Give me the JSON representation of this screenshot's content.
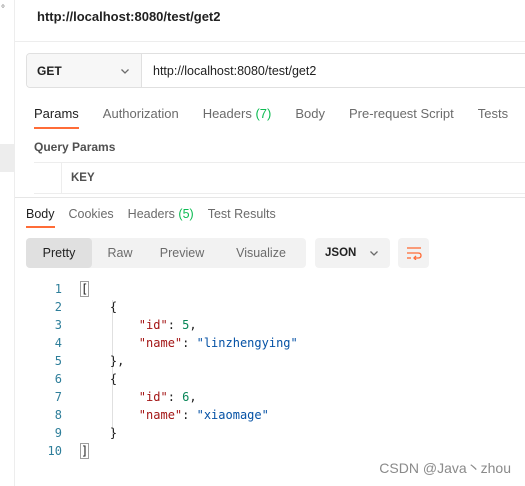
{
  "sidebar": {
    "icon": "dot-icon",
    "glyph": "°"
  },
  "request": {
    "title": "http://localhost:8080/test/get2",
    "method": "GET",
    "url": "http://localhost:8080/test/get2"
  },
  "request_tabs": {
    "params": "Params",
    "authorization": "Authorization",
    "headers": "Headers",
    "headers_count": "(7)",
    "body": "Body",
    "prerequest": "Pre-request Script",
    "tests": "Tests"
  },
  "query_params": {
    "label": "Query Params",
    "key_header": "KEY"
  },
  "response_tabs": {
    "body": "Body",
    "cookies": "Cookies",
    "headers": "Headers",
    "headers_count": "(5)",
    "test_results": "Test Results"
  },
  "view_modes": {
    "pretty": "Pretty",
    "raw": "Raw",
    "preview": "Preview",
    "visualize": "Visualize"
  },
  "format": {
    "selected": "JSON"
  },
  "code": {
    "lines": [
      "1",
      "2",
      "3",
      "4",
      "5",
      "6",
      "7",
      "8",
      "9",
      "10"
    ],
    "open_array": "[",
    "open_obj": "{",
    "close_obj": "}",
    "close_obj_comma": "},",
    "close_array": "]",
    "key_id": "\"id\"",
    "key_name": "\"name\"",
    "id1": "5",
    "name1": "\"linzhengying\"",
    "id2": "6",
    "name2": "\"xiaomage\""
  },
  "watermark": "CSDN @Java丶zhou",
  "colors": {
    "accent": "#ff6c37",
    "count_green": "#0cbb52",
    "json_key": "#a31515",
    "json_string": "#0451a5",
    "json_number": "#098658"
  }
}
